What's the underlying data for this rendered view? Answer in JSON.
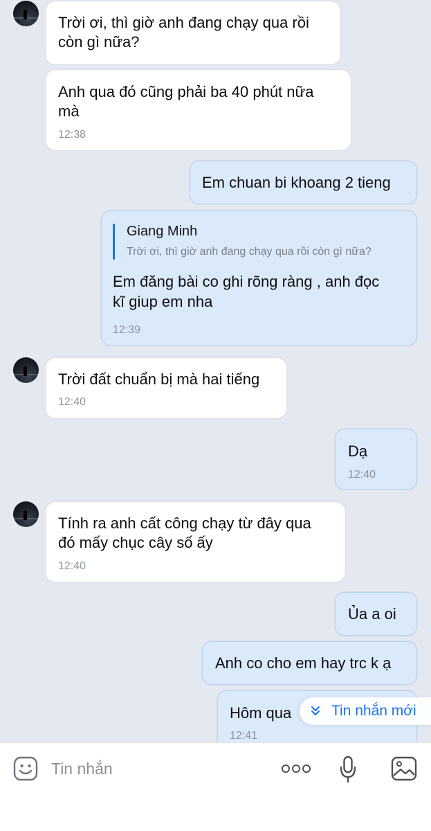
{
  "messages": [
    {
      "direction": "in",
      "text": [
        "Trời ơi, thì giờ anh đang chạy qua rồi",
        "còn gì nữa?"
      ],
      "time": ""
    },
    {
      "direction": "in",
      "text": [
        "Anh qua đó cũng phải ba 40 phút nữa",
        "mà"
      ],
      "time": "12:38"
    },
    {
      "direction": "out",
      "text": [
        "Em chuan bi khoang 2 tieng"
      ],
      "time": ""
    },
    {
      "direction": "out",
      "reply_to": {
        "name": "Giang Minh",
        "quote": "Trời ơi, thì giờ anh đang chạy qua rồi còn gì nữa?"
      },
      "text": [
        "Em đăng bài co ghi rõng ràng , anh đọc",
        "kĩ giup em nha"
      ],
      "time": "12:39"
    },
    {
      "direction": "in",
      "text": [
        "Trời đất chuẩn bị mà hai tiếng"
      ],
      "time": "12:40"
    },
    {
      "direction": "out",
      "text": [
        "Dạ"
      ],
      "time": "12:40"
    },
    {
      "direction": "in",
      "text": [
        "Tính ra anh cất công chạy từ đây qua",
        "đó mấy chục cây số ấy"
      ],
      "time": "12:40"
    },
    {
      "direction": "out",
      "text": [
        "Ủa a oi"
      ],
      "time": ""
    },
    {
      "direction": "out",
      "text": [
        "Anh co cho em hay trc k ạ"
      ],
      "time": ""
    },
    {
      "direction": "out",
      "text": [
        "Hôm qua"
      ],
      "time": "12:41"
    }
  ],
  "new_messages_label": "Tin nhắn mới",
  "composer": {
    "placeholder": "Tin nhắn",
    "icons": [
      "sticker-icon",
      "more-icon",
      "microphone-icon",
      "image-icon"
    ]
  },
  "colors": {
    "background": "#e4e8f0",
    "incoming_bubble": "#ffffff",
    "outgoing_bubble": "#dbeafb",
    "accent": "#1a73e8"
  }
}
